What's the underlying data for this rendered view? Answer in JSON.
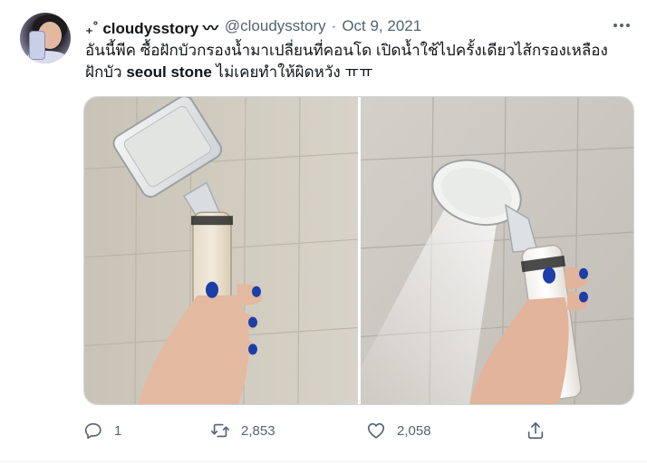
{
  "tweet": {
    "display_name": "₊˚ cloudysstory 〰",
    "handle": "@cloudysstory",
    "separator": "·",
    "date": "Oct 9, 2021",
    "more_icon": "more-horizontal-icon",
    "text_part1": "อันนี้พีค ซื้อฝักบัวกรองน้ำมาเปลี่ยนที่คอนโด เปิดน้ำใช้ไปครั้งเดียวไส้กรองเหลือง ฝักบัว ",
    "text_bold": "seoul stone",
    "text_part2": " ไม่เคยทำให้ผิดหวัง ㅠㅠ",
    "photos": [
      {
        "name": "photo-shower-filter-held"
      },
      {
        "name": "photo-shower-filter-spraying"
      }
    ]
  },
  "actions": {
    "reply": {
      "icon": "reply-icon",
      "count": "1"
    },
    "retweet": {
      "icon": "retweet-icon",
      "count": "2,853"
    },
    "like": {
      "icon": "heart-icon",
      "count": "2,058"
    },
    "share": {
      "icon": "share-icon",
      "count": ""
    }
  },
  "colors": {
    "text_primary": "#0f1419",
    "text_secondary": "#536471",
    "border": "#cfd9de"
  }
}
